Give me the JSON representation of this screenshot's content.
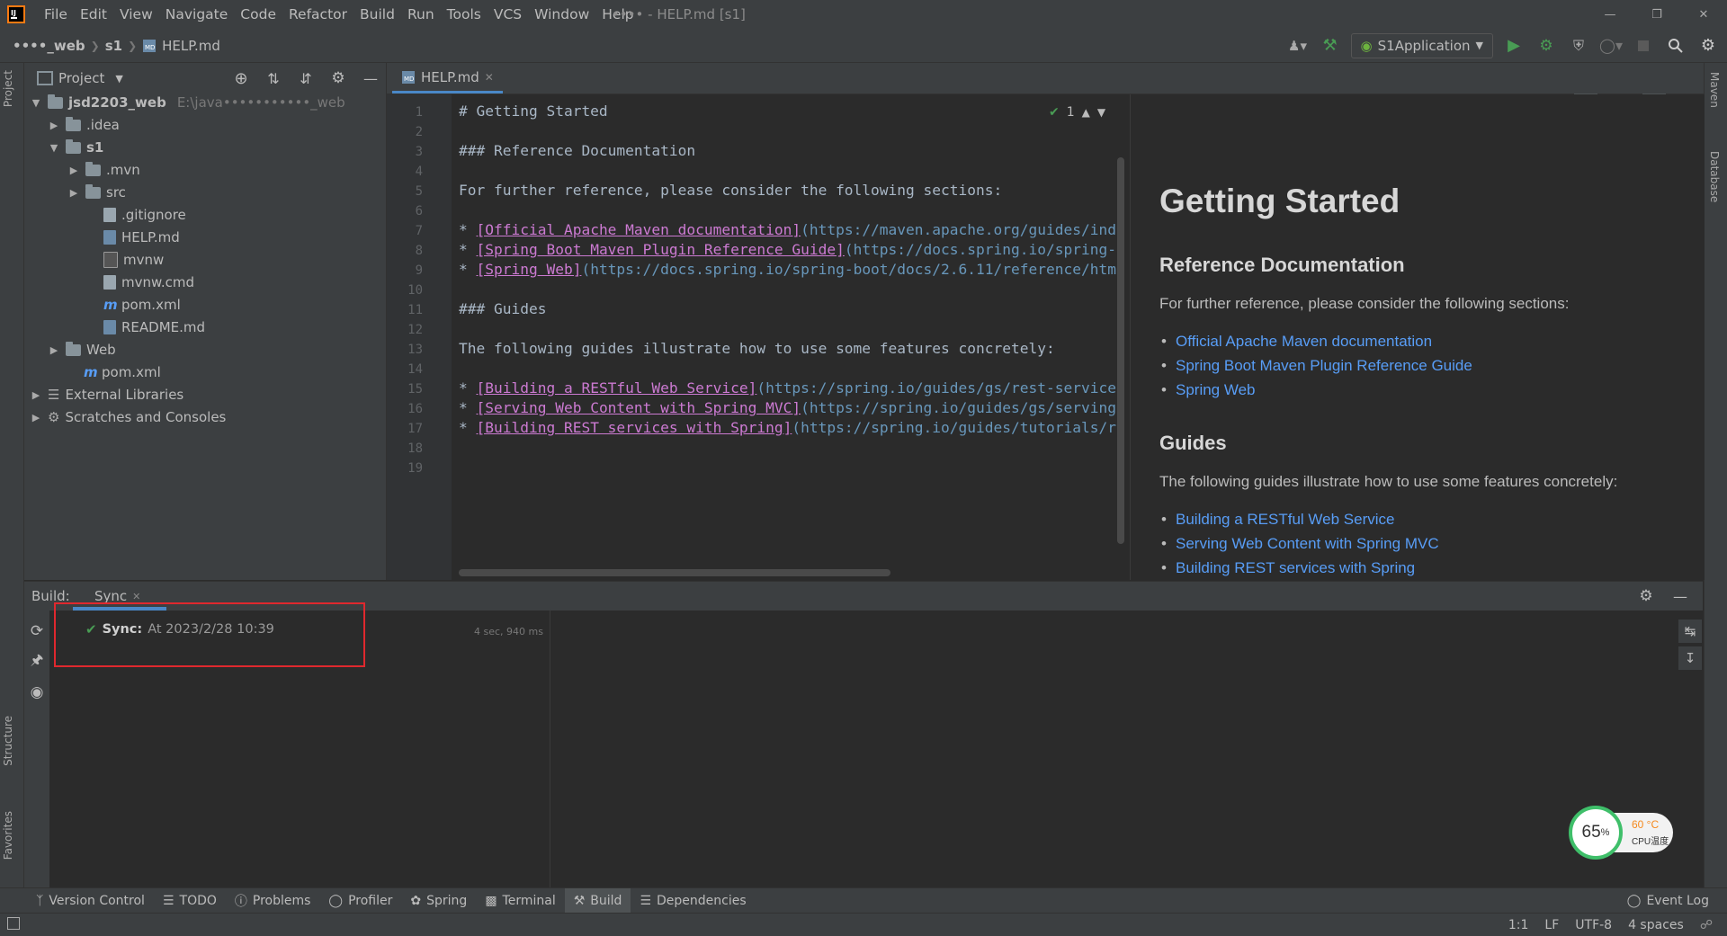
{
  "menubar": {
    "items": [
      "File",
      "Edit",
      "View",
      "Navigate",
      "Code",
      "Refactor",
      "Build",
      "Run",
      "Tools",
      "VCS",
      "Window",
      "Help"
    ],
    "window_title": "•••• - HELP.md [s1]"
  },
  "navbar": {
    "breadcrumb": [
      "••••_web",
      "s1",
      "HELP.md"
    ],
    "run_config": "S1Application"
  },
  "left_stripe": {
    "project": "Project",
    "structure": "Structure",
    "favorites": "Favorites"
  },
  "right_stripe": {
    "maven": "Maven",
    "database": "Database"
  },
  "project": {
    "title": "Project",
    "tree": [
      {
        "label": "jsd2203_web",
        "extra": "E:\\java•••••••••••_web",
        "type": "module"
      },
      {
        "label": ".idea",
        "type": "folder"
      },
      {
        "label": "s1",
        "type": "module"
      },
      {
        "label": ".mvn",
        "type": "folder"
      },
      {
        "label": "src",
        "type": "folder"
      },
      {
        "label": ".gitignore",
        "type": "file"
      },
      {
        "label": "HELP.md",
        "type": "file"
      },
      {
        "label": "mvnw",
        "type": "file"
      },
      {
        "label": "mvnw.cmd",
        "type": "file"
      },
      {
        "label": "pom.xml",
        "type": "maven"
      },
      {
        "label": "README.md",
        "type": "file"
      },
      {
        "label": "Web",
        "type": "folder"
      },
      {
        "label": "pom.xml",
        "type": "maven"
      },
      {
        "label": "External Libraries",
        "type": "lib"
      },
      {
        "label": "Scratches and Consoles",
        "type": "scratch"
      }
    ]
  },
  "editor": {
    "tab": "HELP.md",
    "inspection_count": "1",
    "line_numbers": [
      "1",
      "2",
      "3",
      "4",
      "5",
      "6",
      "7",
      "8",
      "9",
      "10",
      "11",
      "12",
      "13",
      "14",
      "15",
      "16",
      "17",
      "18",
      "19"
    ],
    "lines": {
      "l1": "# Getting Started",
      "l3": "### Reference Documentation",
      "l5": "For further reference, please consider the following sections:",
      "l7_link": "[Official Apache Maven documentation]",
      "l7_url": "(https://maven.apache.org/guides/ind",
      "l8_link": "[Spring Boot Maven Plugin Reference Guide]",
      "l8_url": "(https://docs.spring.io/spring-",
      "l9_link": "[Spring Web]",
      "l9_url": "(https://docs.spring.io/spring-boot/docs/2.6.11/reference/htm",
      "l11": "### Guides",
      "l13": "The following guides illustrate how to use some features concretely:",
      "l15_link": "[Building a RESTful Web Service]",
      "l15_url": "(https://spring.io/guides/gs/rest-service",
      "l16_link": "[Serving Web Content with Spring MVC]",
      "l16_url": "(https://spring.io/guides/gs/serving",
      "l17_link": "[Building REST services with Spring]",
      "l17_url": "(https://spring.io/guides/tutorials/r",
      "bullet": "* "
    }
  },
  "preview": {
    "h1": "Getting Started",
    "h3_ref": "Reference Documentation",
    "p_ref": "For further reference, please consider the following sections:",
    "ref_links": [
      "Official Apache Maven documentation",
      "Spring Boot Maven Plugin Reference Guide",
      "Spring Web"
    ],
    "h3_guides": "Guides",
    "p_guides": "The following guides illustrate how to use some features concretely:",
    "guide_links": [
      "Building a RESTful Web Service",
      "Serving Web Content with Spring MVC",
      "Building REST services with Spring"
    ]
  },
  "build": {
    "label": "Build:",
    "tab": "Sync",
    "sync_status": "Sync:",
    "sync_time": "At 2023/2/28 10:39",
    "duration": "4 sec, 940 ms"
  },
  "cpu_widget": {
    "percent": "65",
    "percent_unit": "%",
    "temp": "60 °C",
    "label": "CPU温度"
  },
  "bottom_toolbar": {
    "items": [
      "Version Control",
      "TODO",
      "Problems",
      "Profiler",
      "Spring",
      "Terminal",
      "Build",
      "Dependencies"
    ],
    "event_log": "Event Log"
  },
  "status_bar": {
    "position": "1:1",
    "line_sep": "LF",
    "encoding": "UTF-8",
    "indent": "4 spaces"
  },
  "colors": {
    "accent": "#4a88c7",
    "highlight_box": "#e0282e",
    "link": "#589df6",
    "md_link": "#cc7ad2",
    "run_green": "#499c54"
  }
}
